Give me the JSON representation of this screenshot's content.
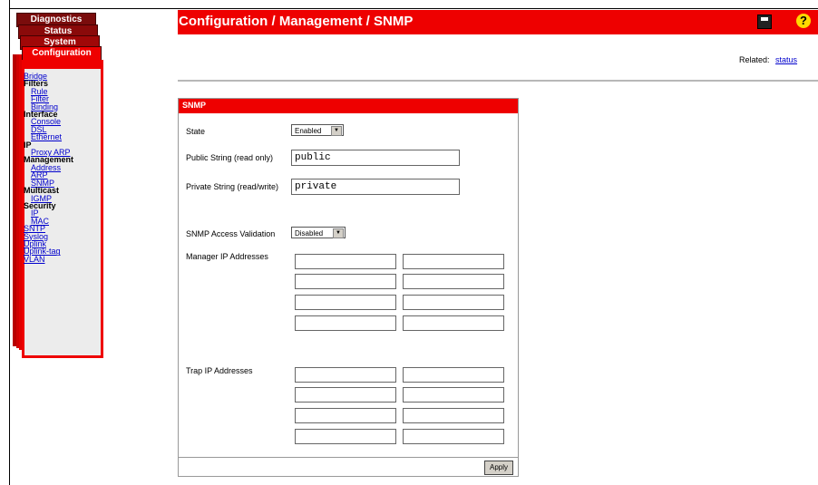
{
  "tabs": [
    {
      "label": "Diagnostics"
    },
    {
      "label": "Status"
    },
    {
      "label": "System"
    },
    {
      "label": "Configuration"
    }
  ],
  "menu": [
    {
      "label": "Bridge",
      "type": "link"
    },
    {
      "label": "Filters",
      "type": "head"
    },
    {
      "label": "Rule",
      "type": "sublink"
    },
    {
      "label": "Filter",
      "type": "sublink"
    },
    {
      "label": "Binding",
      "type": "sublink"
    },
    {
      "label": "Interface",
      "type": "head"
    },
    {
      "label": "Console",
      "type": "sublink"
    },
    {
      "label": "DSL",
      "type": "sublink"
    },
    {
      "label": "Ethernet",
      "type": "sublink"
    },
    {
      "label": "IP",
      "type": "head"
    },
    {
      "label": "Proxy ARP",
      "type": "sublink"
    },
    {
      "label": "Management",
      "type": "head"
    },
    {
      "label": "Address",
      "type": "sublink"
    },
    {
      "label": "ARP",
      "type": "sublink"
    },
    {
      "label": "SNMP",
      "type": "sublink"
    },
    {
      "label": "Multicast",
      "type": "head"
    },
    {
      "label": "IGMP",
      "type": "sublink"
    },
    {
      "label": "Security",
      "type": "head"
    },
    {
      "label": "IP",
      "type": "sublink"
    },
    {
      "label": "MAC",
      "type": "sublink"
    },
    {
      "label": "SNTP",
      "type": "link"
    },
    {
      "label": "Syslog",
      "type": "link"
    },
    {
      "label": "Uplink",
      "type": "link"
    },
    {
      "label": "Uplink-tag",
      "type": "link"
    },
    {
      "label": "VLAN",
      "type": "link"
    }
  ],
  "header": {
    "title": "Configuration / Management / SNMP",
    "save_icon": "save-icon",
    "help_icon": "help-icon",
    "help_glyph": "?"
  },
  "related": {
    "label": "Related:",
    "link": "status"
  },
  "panel": {
    "title": "SNMP",
    "state_label": "State",
    "state_value": "Enabled",
    "public_label": "Public String (read only)",
    "public_value": "public",
    "private_label": "Private String (read/write)",
    "private_value": "private",
    "access_label": "SNMP Access Validation",
    "access_value": "Disabled",
    "manager_label": "Manager IP Addresses",
    "trap_label": "Trap IP Addresses",
    "apply_label": "Apply"
  },
  "colors": {
    "accent": "#ee0000",
    "link": "#0000cc"
  }
}
